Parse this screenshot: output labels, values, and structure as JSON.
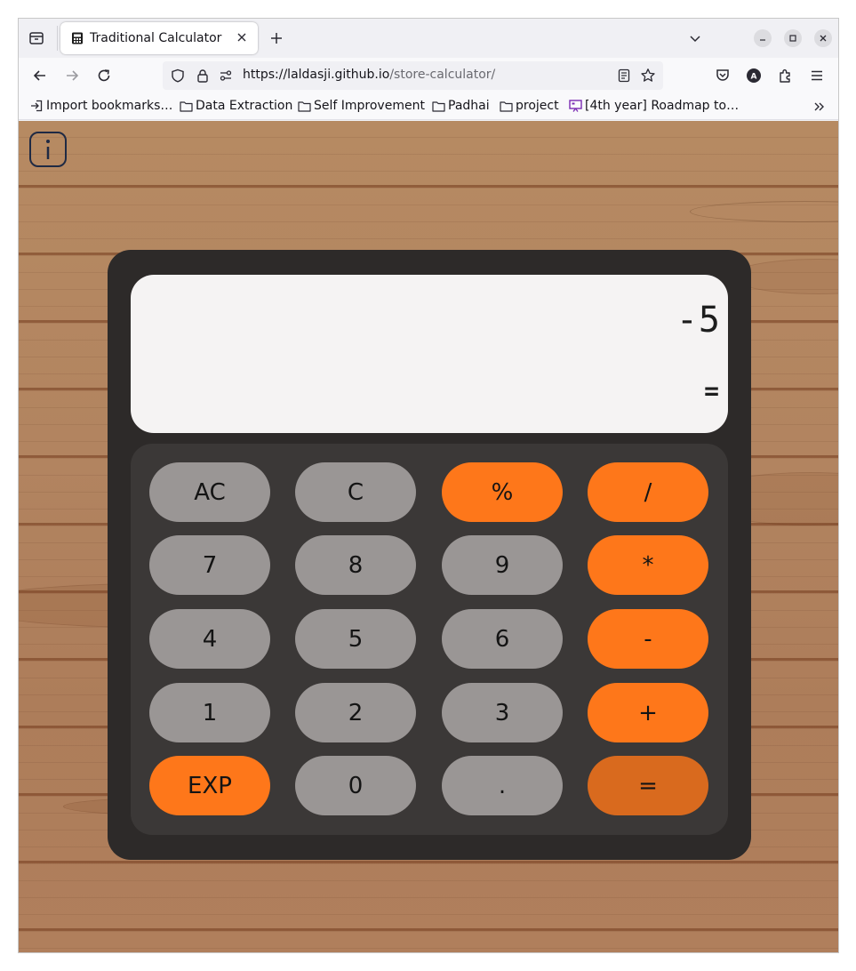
{
  "browser": {
    "tab": {
      "title": "Traditional Calculator"
    },
    "url": {
      "host": "https://laldasji.github.io",
      "path": "/store-calculator/"
    },
    "bookmarks": [
      {
        "label": "Import bookmarks…",
        "icon": "import-icon"
      },
      {
        "label": "Data Extraction",
        "icon": "folder-icon"
      },
      {
        "label": "Self Improvement",
        "icon": "folder-icon"
      },
      {
        "label": "Padhai",
        "icon": "folder-icon"
      },
      {
        "label": "project",
        "icon": "folder-icon"
      },
      {
        "label": "[4th year] Roadmap to…",
        "icon": "presentation-icon"
      }
    ]
  },
  "calculator": {
    "display": {
      "value": "-5",
      "equals": "="
    },
    "keys": [
      {
        "label": "AC",
        "style": "gray"
      },
      {
        "label": "C",
        "style": "gray"
      },
      {
        "label": "%",
        "style": "orange"
      },
      {
        "label": "/",
        "style": "orange"
      },
      {
        "label": "7",
        "style": "gray"
      },
      {
        "label": "8",
        "style": "gray"
      },
      {
        "label": "9",
        "style": "gray"
      },
      {
        "label": "*",
        "style": "orange"
      },
      {
        "label": "4",
        "style": "gray"
      },
      {
        "label": "5",
        "style": "gray"
      },
      {
        "label": "6",
        "style": "gray"
      },
      {
        "label": "-",
        "style": "orange"
      },
      {
        "label": "1",
        "style": "gray"
      },
      {
        "label": "2",
        "style": "gray"
      },
      {
        "label": "3",
        "style": "gray"
      },
      {
        "label": "+",
        "style": "orange"
      },
      {
        "label": "EXP",
        "style": "orange"
      },
      {
        "label": "0",
        "style": "gray"
      },
      {
        "label": ".",
        "style": "gray"
      },
      {
        "label": "=",
        "style": "dark-orange"
      }
    ]
  },
  "colors": {
    "key_gray": "#9a9695",
    "key_orange": "#fe771a",
    "key_equals": "#d96a1e",
    "calculator_body": "#2d2a29",
    "display_bg": "#f5f3f3",
    "wood": "#b28460"
  }
}
